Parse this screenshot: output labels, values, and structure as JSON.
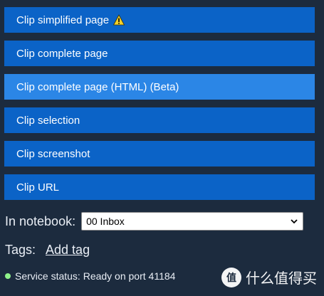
{
  "clip_buttons": [
    {
      "label": "Clip simplified page",
      "icon": "warning-icon",
      "active": false
    },
    {
      "label": "Clip complete page",
      "active": false
    },
    {
      "label": "Clip complete page (HTML) (Beta)",
      "active": true
    },
    {
      "label": "Clip selection",
      "active": false
    },
    {
      "label": "Clip screenshot",
      "active": false
    },
    {
      "label": "Clip URL",
      "active": false
    }
  ],
  "notebook": {
    "label": "In notebook:",
    "selected": "00 Inbox"
  },
  "tags": {
    "label": "Tags:",
    "add_label": "Add tag"
  },
  "status": {
    "text": "Service status: Ready on port 41184",
    "color": "#8ff28a"
  },
  "watermark": {
    "text": "什么值得买",
    "logo_char": "值"
  },
  "colors": {
    "background": "#1c2b3e",
    "button": "#0b63c7",
    "button_active": "#2b86e6"
  }
}
